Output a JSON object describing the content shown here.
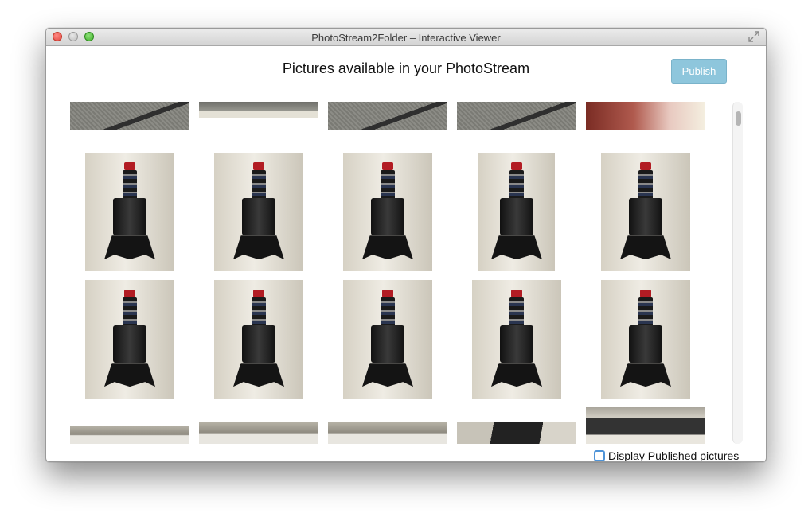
{
  "window": {
    "title": "PhotoStream2Folder – Interactive Viewer"
  },
  "header": {
    "title": "Pictures available in your PhotoStream",
    "publish_label": "Publish"
  },
  "footer": {
    "display_published_label": "Display Published pictures",
    "display_published_checked": false
  },
  "icons": {
    "close": "close-traffic-light",
    "minimize": "minimize-traffic-light",
    "zoom": "zoom-traffic-light",
    "fullscreen": "fullscreen-arrows-icon"
  },
  "colors": {
    "publish_button": "#8ec6dc",
    "checkbox_border": "#4f94d8",
    "close": "#e0443e",
    "zoom": "#3fae2a"
  }
}
